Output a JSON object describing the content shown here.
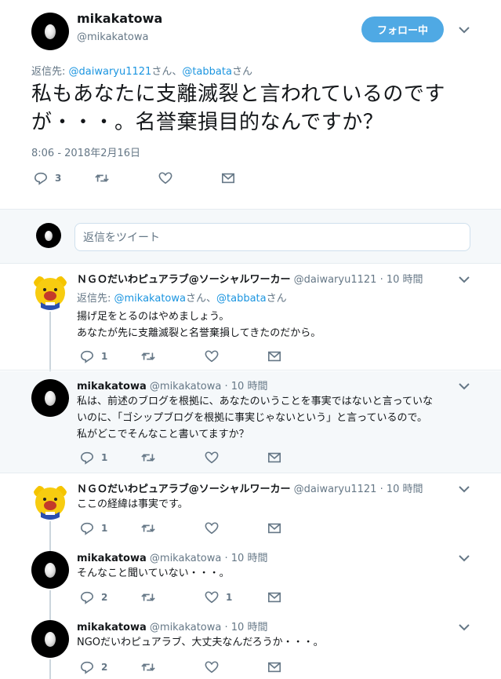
{
  "main": {
    "name": "mikakatowa",
    "handle": "@mikakatowa",
    "follow_label": "フォロー中",
    "reply_prefix": "返信先: ",
    "reply_user1": "@daiwaryu1121",
    "reply_mid": "さん、",
    "reply_user2": "@tabbata",
    "reply_suffix": "さん",
    "text": "私もあなたに支離滅裂と言われているのですが・・・。名誉棄損目的なんですか？",
    "timestamp": "8:06 - 2018年2月16日",
    "reply_count": "3"
  },
  "reply_box": {
    "placeholder": "返信をツイート"
  },
  "tweets": [
    {
      "name": "ＮＧＯだいわピュアラブ@ソーシャルワーカー",
      "handle": "@daiwaryu1121",
      "time": "10 時間",
      "reply_prefix": "返信先: ",
      "reply_user1": "@mikakatowa",
      "reply_mid": "さん、",
      "reply_user2": "@tabbata",
      "reply_suffix": "さん",
      "line1": "揚げ足をとるのはやめましょう。",
      "line2": "あなたが先に支離滅裂と名誉棄損してきたのだから。",
      "reply_count": "1",
      "like_count": ""
    },
    {
      "name": "mikakatowa",
      "handle": "@mikakatowa",
      "time": "10 時間",
      "line1": "私は、前述のブログを根拠に、あなたのいうことを事実ではないと言っていな",
      "line2": "いのに、「ゴシップブログを根拠に事実じゃないという」と言っているので。",
      "line3": "私がどこでそんなこと書いてますか？",
      "reply_count": "1",
      "like_count": ""
    },
    {
      "name": "ＮＧＯだいわピュアラブ@ソーシャルワーカー",
      "handle": "@daiwaryu1121",
      "time": "10 時間",
      "line1": "ここの経緯は事実です。",
      "reply_count": "1",
      "like_count": ""
    },
    {
      "name": "mikakatowa",
      "handle": "@mikakatowa",
      "time": "10 時間",
      "line1": "そんなこと聞いていない・・・。",
      "reply_count": "2",
      "like_count": "1"
    },
    {
      "name": "mikakatowa",
      "handle": "@mikakatowa",
      "time": "10 時間",
      "line1": "NGOだいわピュアラブ、大丈夫なんだろうか・・・。",
      "reply_count": "2",
      "like_count": ""
    }
  ],
  "colors": {
    "accent": "#1b95e0",
    "follow_bg": "#4fa9e4",
    "muted": "#657786",
    "thread": "#ccd6dd"
  },
  "icons": [
    "reply-icon",
    "retweet-icon",
    "like-icon",
    "dm-icon",
    "chevron-down-icon",
    "egg-avatar",
    "bear-avatar"
  ]
}
